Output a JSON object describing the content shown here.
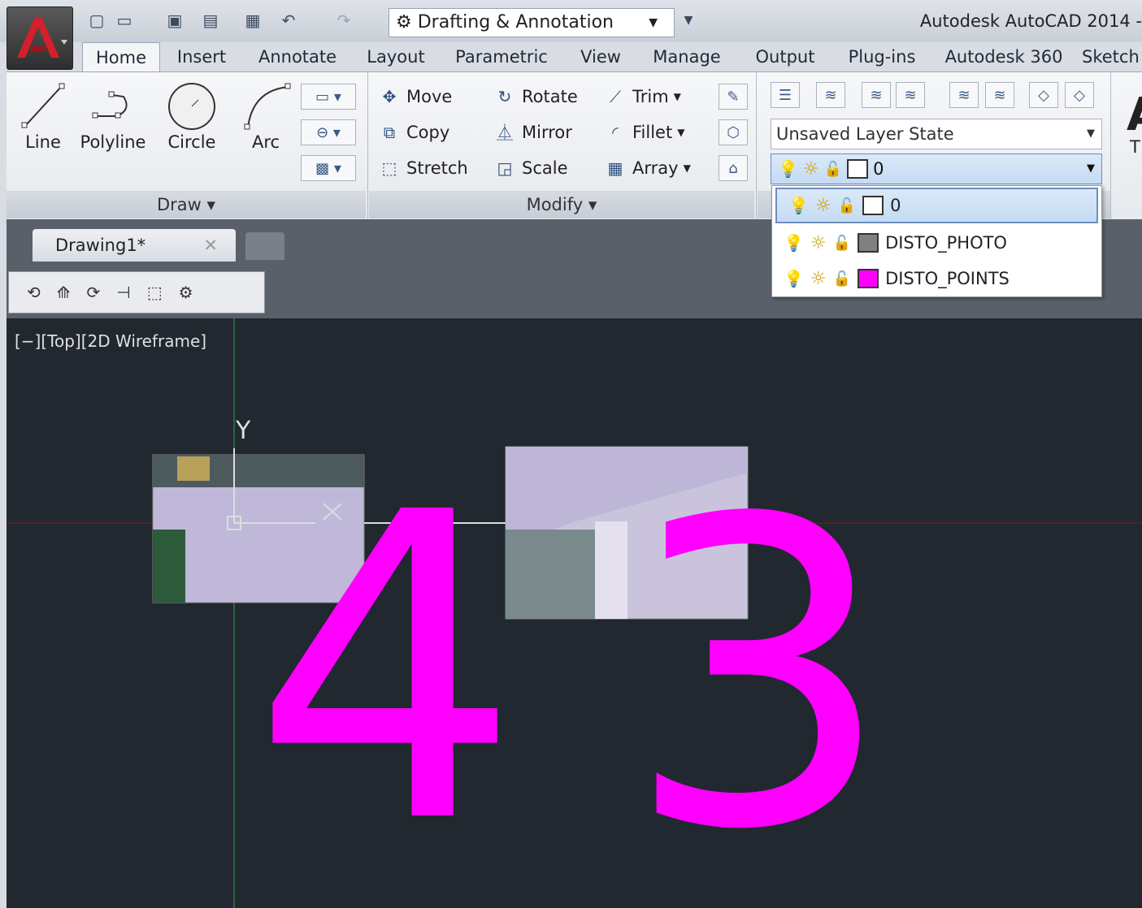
{
  "app": {
    "title": "Autodesk AutoCAD 2014 -"
  },
  "quick_access": {
    "workspace": "Drafting & Annotation"
  },
  "tabs": [
    "Home",
    "Insert",
    "Annotate",
    "Layout",
    "Parametric",
    "View",
    "Manage",
    "Output",
    "Plug-ins",
    "Autodesk 360",
    "Sketch"
  ],
  "draw": {
    "line": "Line",
    "polyline": "Polyline",
    "circle": "Circle",
    "arc": "Arc",
    "panel": "Draw ▾"
  },
  "modify": {
    "move": "Move",
    "rotate": "Rotate",
    "trim": "Trim",
    "copy": "Copy",
    "mirror": "Mirror",
    "fillet": "Fillet",
    "stretch": "Stretch",
    "scale": "Scale",
    "array": "Array",
    "panel": "Modify ▾"
  },
  "layers": {
    "state": "Unsaved Layer State",
    "current": "0",
    "items": [
      {
        "name": "0",
        "color": "#ffffff"
      },
      {
        "name": "DISTO_PHOTO",
        "color": "#808080"
      },
      {
        "name": "DISTO_POINTS",
        "color": "#ff00ff"
      }
    ]
  },
  "document": {
    "tab": "Drawing1*"
  },
  "viewport": {
    "label": "[−][Top][2D Wireframe]",
    "axis_y": "Y",
    "text_left": "4",
    "text_right": "3",
    "text_color": "#ff00ff"
  }
}
